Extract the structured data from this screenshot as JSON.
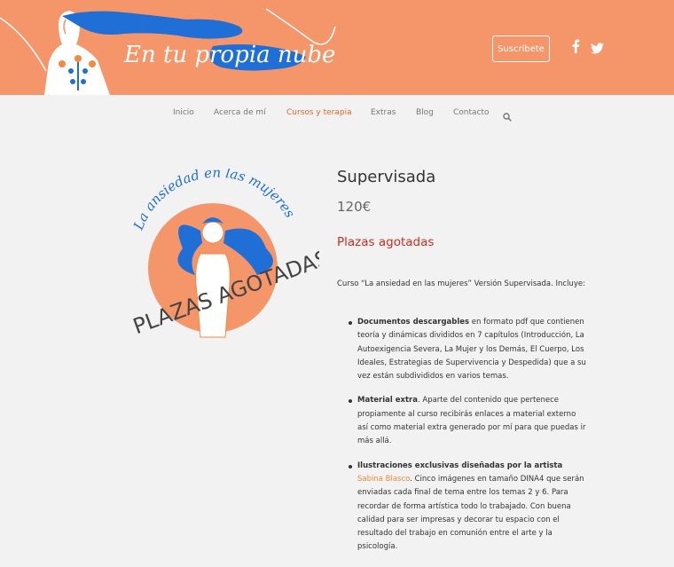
{
  "header": {
    "logo_text": "En tu propia nube",
    "subscribe_label": "Suscríbete",
    "social": [
      {
        "name": "facebook-icon",
        "glyph": "f"
      },
      {
        "name": "twitter-icon",
        "glyph": "🐦"
      }
    ],
    "bg_color": "#f4956a"
  },
  "nav": {
    "items": [
      "Inicio",
      "Acerca de mí",
      "Cursos y terapia",
      "Extras",
      "Blog",
      "Contacto"
    ],
    "active": "Cursos y terapia",
    "search_icon": "search-icon"
  },
  "product": {
    "image_caption": "La ansiedad en las mujeres",
    "stamp": "PLAZAS AGOTADAS",
    "title": "Supervisada",
    "price": "120€",
    "stock_status": "Plazas agotadas",
    "intro": "Curso “La ansiedad en las mujeres” Versión Supervisada. Incluye:",
    "features": [
      {
        "bold": "Documentos descargables",
        "text": " en formato pdf que contienen teoría y dinámicas divididos en 7 capítulos (Introducción, La Autoexigencia Severa, La Mujer y los Demás, El Cuerpo, Los Ideales, Estrategias de Supervivencia y Despedida) que a su vez están subdivididos en varios temas."
      },
      {
        "bold": "Material extra",
        "text": ". Aparte del contenido que pertenece propiamente al curso recibirás enlaces a material externo así como material extra generado por mí para que puedas ir más allá."
      },
      {
        "bold": "Ilustraciones exclusivas diseñadas por la artista",
        "link": "Sabina Blasco",
        "text": ". Cinco imágenes en tamaño DINA4 que serán enviadas cada final de tema entre los temas 2 y 6. Para recordar de forma artística todo lo trabajado. Con buena calidad para ser impresas y decorar tu espacio con el resultado del trabajo en comunión entre el arte y la psicología."
      }
    ]
  }
}
